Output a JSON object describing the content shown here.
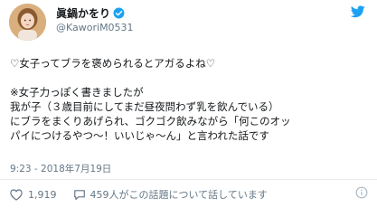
{
  "tweet": {
    "display_name": "眞鍋かをり",
    "handle": "@KaworiM0531",
    "verified_color": "#1da1f2",
    "brand_color": "#1da1f2",
    "lines": [
      "♡女子ってブラを褒められるとアガるよね♡",
      "",
      "※女子力っぽく書きましたが",
      "我が子（３歳目前にしてまだ昼夜問わず乳を飲んでいる）",
      "にブラをまくりあげられ、ゴクゴク飲みながら「何このオッ",
      "パイにつけるやつ～！いいじゃ～ん」と言われた話です"
    ],
    "timestamp": "9:23 - 2018年7月19日",
    "like_count": "1,919",
    "talk_text": "459人がこの話題について話しています"
  },
  "icons": {
    "avatar": "avatar",
    "verified": "verified-badge-icon",
    "twitter": "twitter-bird-icon",
    "like": "heart-icon",
    "comment": "speech-bubble-icon",
    "info": "info-icon"
  }
}
